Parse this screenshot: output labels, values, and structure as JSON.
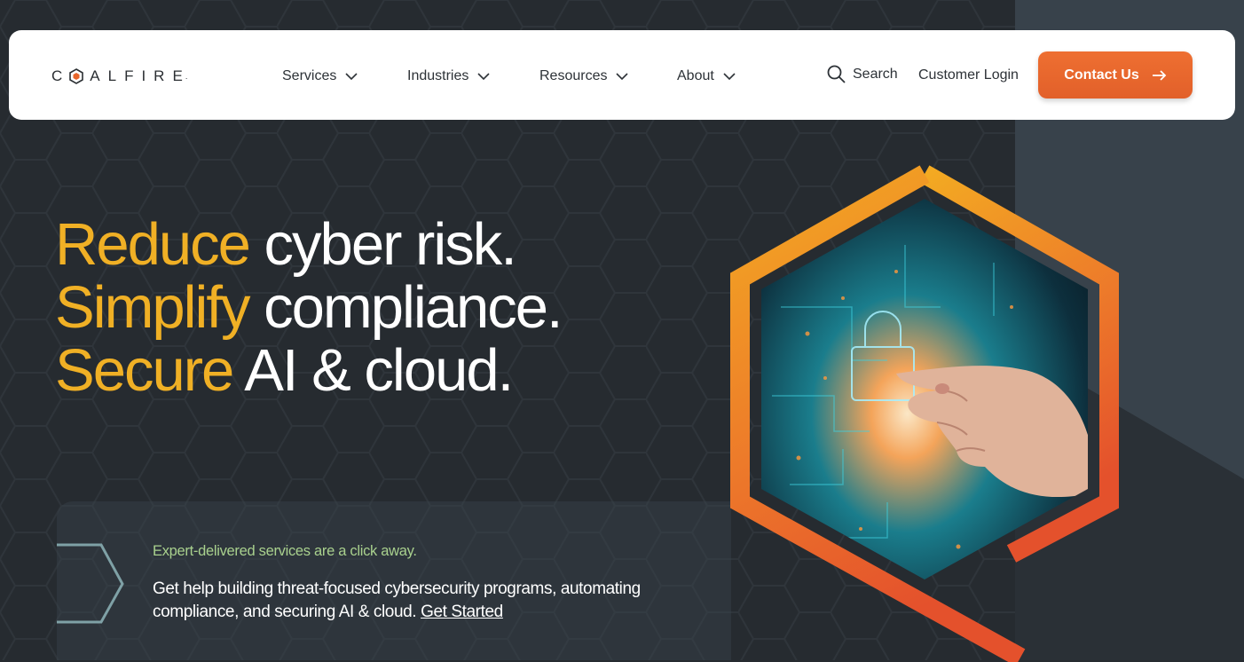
{
  "brand": {
    "name": "COALFIRE",
    "accent_orange": "#e8652a",
    "accent_yellow": "#f0b025",
    "accent_green": "#a9d18e"
  },
  "nav": {
    "items": [
      {
        "label": "Services",
        "icon": "chevron-down-icon"
      },
      {
        "label": "Industries",
        "icon": "chevron-down-icon"
      },
      {
        "label": "Resources",
        "icon": "chevron-down-icon"
      },
      {
        "label": "About",
        "icon": "chevron-down-icon"
      }
    ],
    "search_label": "Search",
    "login_label": "Customer Login",
    "contact_label": "Contact Us"
  },
  "hero": {
    "line1_accent": "Reduce",
    "line1_rest": " cyber risk.",
    "line2_accent": "Simplify",
    "line2_rest": " compliance.",
    "line3_accent": "Secure",
    "line3_rest": " AI & cloud."
  },
  "card": {
    "subheading": "Expert-delivered services are a click away.",
    "body": "Get help building threat-focused cybersecurity programs, automating compliance, and securing AI & cloud.",
    "link_label": "Get Started"
  },
  "image": {
    "subject": "hand-touching-digital-lock-image"
  }
}
